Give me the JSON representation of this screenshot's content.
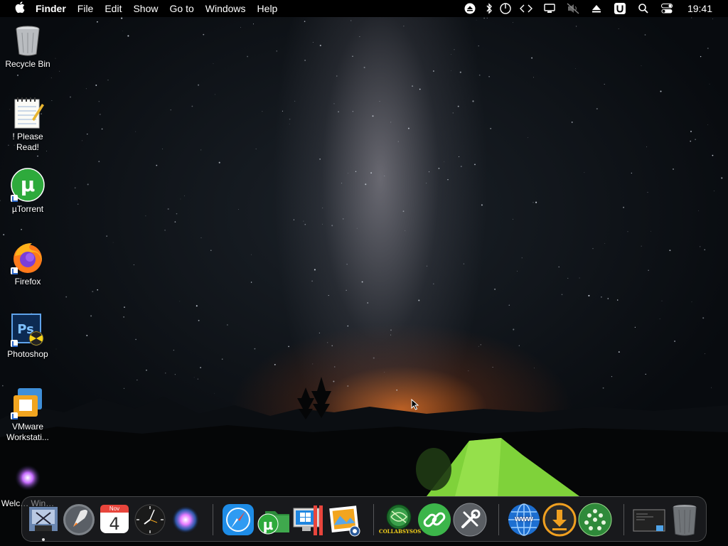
{
  "menubar": {
    "app_name": "Finder",
    "items": [
      "File",
      "Edit",
      "Show",
      "Go to",
      "Windows",
      "Help"
    ],
    "clock": "19:41",
    "status_icons": [
      "eject-icon",
      "bluetooth-icon",
      "power-icon",
      "code-icon",
      "display-icon",
      "muted-speaker-icon",
      "eject-triangle-icon",
      "u-app-icon",
      "search-icon",
      "control-center-icon"
    ]
  },
  "desktop": {
    "icons": [
      {
        "label": "Recycle Bin",
        "icon": "recycle-bin-icon"
      },
      {
        "label": "! Please Read!",
        "icon": "notepad-icon"
      },
      {
        "label": "µTorrent",
        "icon": "utorrent-icon"
      },
      {
        "label": "Firefox",
        "icon": "firefox-icon"
      },
      {
        "label": "Photoshop",
        "icon": "photoshop-icon"
      },
      {
        "label": "VMware Workstati...",
        "icon": "vmware-icon"
      },
      {
        "label": "Welc… Win…",
        "icon": "siri-icon"
      }
    ]
  },
  "dock": {
    "calendar": {
      "month": "Nov",
      "day": "4"
    },
    "collabs_label": "COLLABSYSOS",
    "www_label": "www",
    "items": [
      "finder-preview-icon",
      "launchpad-icon",
      "calendar-icon",
      "clock-icon",
      "siri-icon",
      "safari-icon",
      "utorrent-folder-icon",
      "parallels-icon",
      "photo-viewer-icon",
      "collabs-icon",
      "link-icon",
      "tools-icon",
      "www-globe-icon",
      "download-icon",
      "network-icon",
      "screenshot-icon",
      "trash-icon"
    ]
  },
  "colors": {
    "menubar_bg": "#000000",
    "utorrent_green": "#2eaa3c",
    "safari_blue": "#1e8ce6",
    "download_orange": "#f0a020"
  }
}
